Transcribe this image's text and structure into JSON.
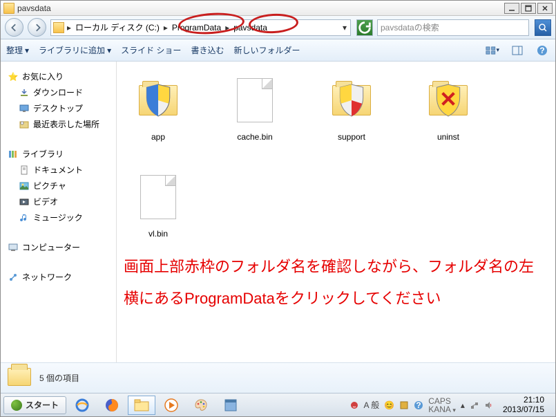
{
  "window": {
    "title": "pavsdata"
  },
  "winbtns": {
    "min": "_",
    "max": "☐",
    "close": "✕"
  },
  "breadcrumb": {
    "root": "ローカル ディスク (C:)",
    "p1": "ProgramData",
    "p2": "pavsdata"
  },
  "search": {
    "placeholder": "pavsdataの検索"
  },
  "toolbar": {
    "organize": "整理",
    "library": "ライブラリに追加",
    "slideshow": "スライド ショー",
    "burn": "書き込む",
    "newfolder": "新しいフォルダー"
  },
  "sidebar": {
    "fav_title": "お気に入り",
    "fav": [
      "ダウンロード",
      "デスクトップ",
      "最近表示した場所"
    ],
    "lib_title": "ライブラリ",
    "lib": [
      "ドキュメント",
      "ピクチャ",
      "ビデオ",
      "ミュージック"
    ],
    "computer": "コンピューター",
    "network": "ネットワーク"
  },
  "items": {
    "app": "app",
    "cache": "cache.bin",
    "support": "support",
    "uninst": "uninst",
    "vl": "vl.bin"
  },
  "instruction": "画面上部赤枠のフォルダ名を確認しながら、フォルダ名の左横にあるProgramDataをクリックしてください",
  "details": {
    "count": "5 個の項目"
  },
  "taskbar": {
    "start": "スタート",
    "ime": "A 般",
    "caps1": "CAPS",
    "caps2": "KANA",
    "time": "21:10",
    "date": "2013/07/15"
  }
}
